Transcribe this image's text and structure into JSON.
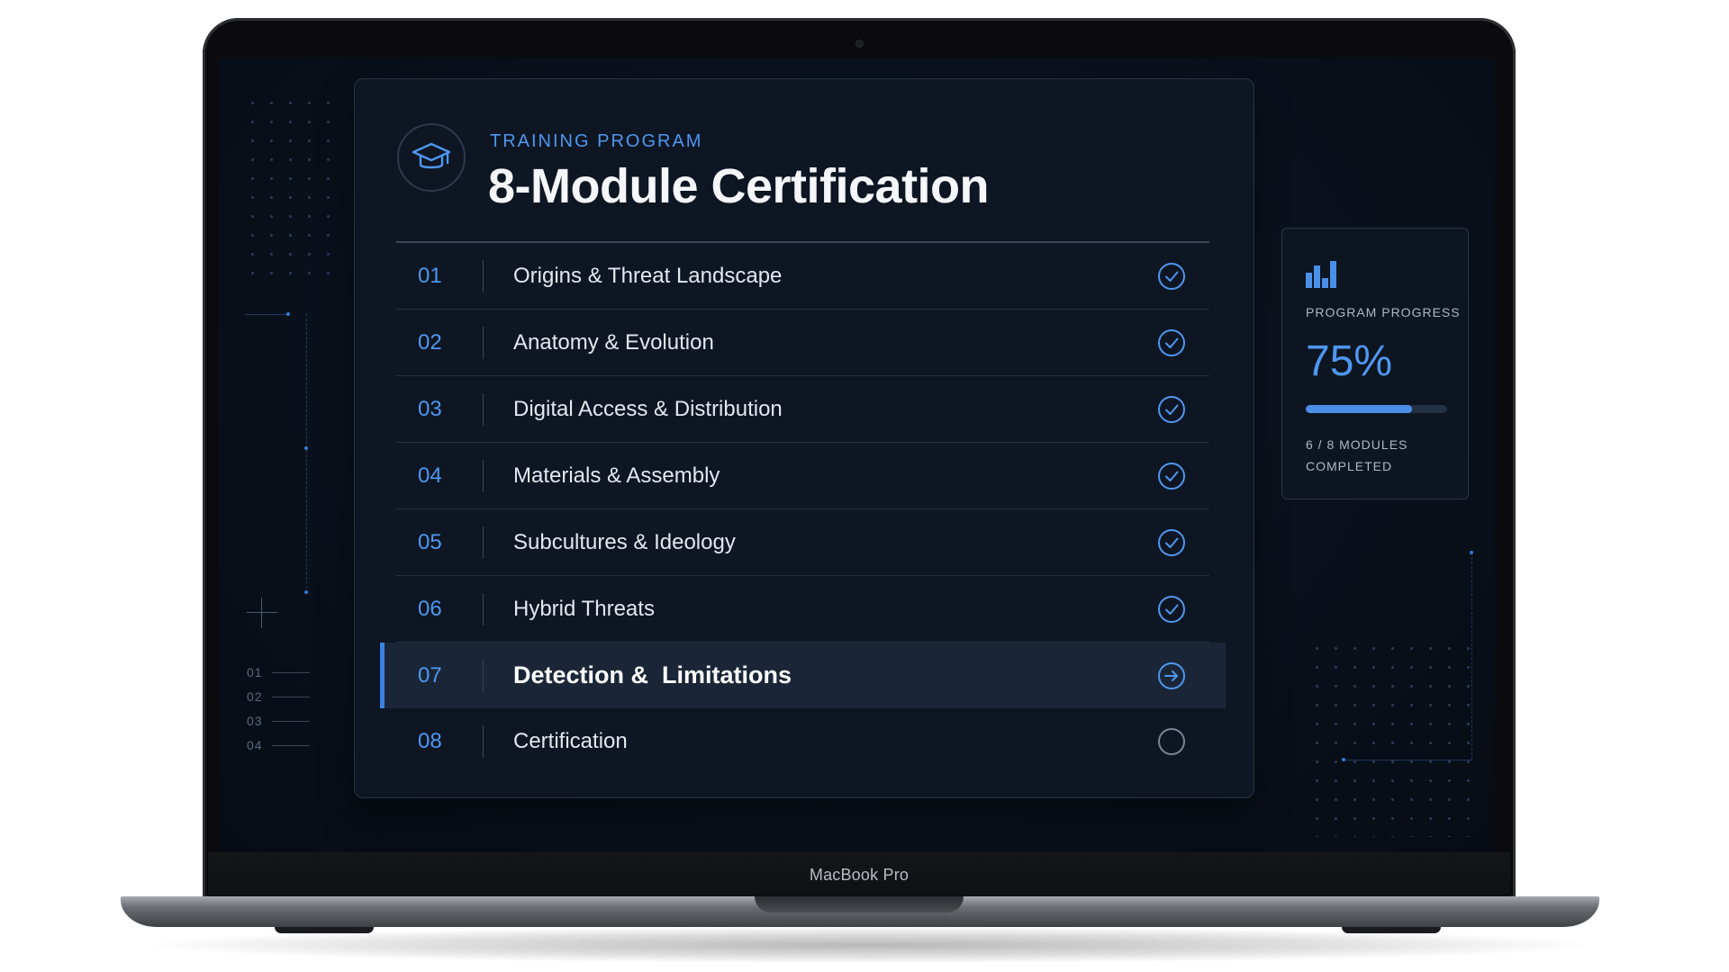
{
  "device": {
    "brand_label": "MacBook Pro"
  },
  "side_legend": [
    "01",
    "02",
    "03",
    "04"
  ],
  "header": {
    "eyebrow": "TRAINING PROGRAM",
    "title": "8-Module Certification",
    "icon": "graduation-cap-icon"
  },
  "modules": [
    {
      "number": "01",
      "title": "Origins & Threat Landscape",
      "status": "completed",
      "icon": "check-circle-icon"
    },
    {
      "number": "02",
      "title": "Anatomy & Evolution",
      "status": "completed",
      "icon": "check-circle-icon"
    },
    {
      "number": "03",
      "title": "Digital Access & Distribution",
      "status": "completed",
      "icon": "check-circle-icon"
    },
    {
      "number": "04",
      "title": "Materials & Assembly",
      "status": "completed",
      "icon": "check-circle-icon"
    },
    {
      "number": "05",
      "title": "Subcultures & Ideology",
      "status": "completed",
      "icon": "check-circle-icon"
    },
    {
      "number": "06",
      "title": "Hybrid Threats",
      "status": "completed",
      "icon": "check-circle-icon"
    },
    {
      "number": "07",
      "title": "Detection &  Limitations",
      "status": "in-progress",
      "icon": "arrow-circle-icon"
    },
    {
      "number": "08",
      "title": "Certification",
      "status": "not-started",
      "icon": "empty-circle-icon"
    }
  ],
  "progress": {
    "icon": "bar-chart-icon",
    "label": "PROGRAM PROGRESS",
    "value": "75%",
    "fraction": 0.75,
    "modules_completed": "6 / 8 MODULES COMPLETED"
  },
  "colors": {
    "accent": "#4e97ef",
    "card_bg": "#0e1623",
    "active_row_bg": "#1a2638",
    "screen_bg": "#0a111c"
  }
}
